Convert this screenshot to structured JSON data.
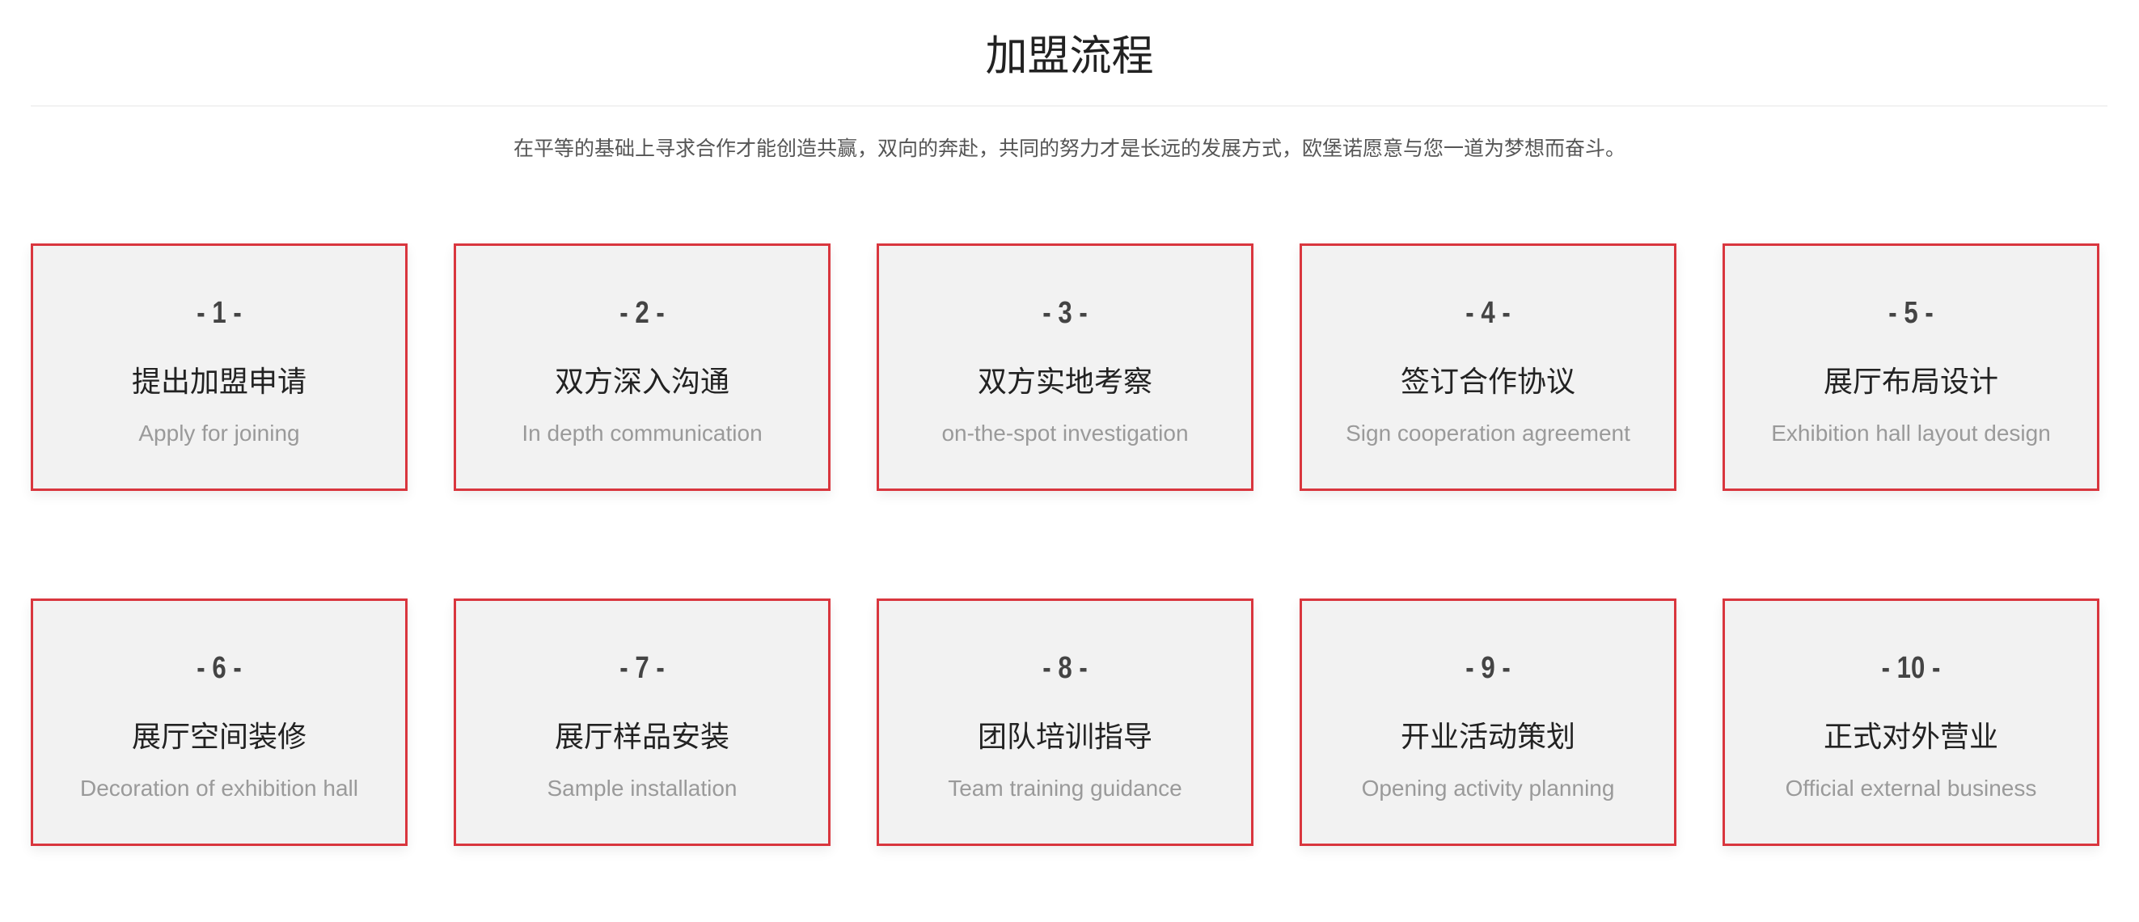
{
  "section": {
    "title": "加盟流程",
    "subtitle": "在平等的基础上寻求合作才能创造共赢，双向的奔赴，共同的努力才是长远的发展方式，欧堡诺愿意与您一道为梦想而奋斗。"
  },
  "colors": {
    "card_border": "#d9363e",
    "card_background": "#f2f2f2",
    "number_text": "#444444",
    "title_text": "#222222",
    "subtitle_text": "#9a9a9a"
  },
  "steps": [
    {
      "number": "- 1 -",
      "title": "提出加盟申请",
      "subtitle": "Apply for joining"
    },
    {
      "number": "- 2 -",
      "title": "双方深入沟通",
      "subtitle": "In depth communication"
    },
    {
      "number": "- 3 -",
      "title": "双方实地考察",
      "subtitle": "on-the-spot investigation"
    },
    {
      "number": "- 4 -",
      "title": "签订合作协议",
      "subtitle": "Sign cooperation agreement"
    },
    {
      "number": "- 5 -",
      "title": "展厅布局设计",
      "subtitle": "Exhibition hall layout design"
    },
    {
      "number": "- 6 -",
      "title": "展厅空间装修",
      "subtitle": "Decoration of exhibition hall"
    },
    {
      "number": "- 7 -",
      "title": "展厅样品安装",
      "subtitle": "Sample installation"
    },
    {
      "number": "- 8 -",
      "title": "团队培训指导",
      "subtitle": "Team training guidance"
    },
    {
      "number": "- 9 -",
      "title": "开业活动策划",
      "subtitle": "Opening activity planning"
    },
    {
      "number": "- 10 -",
      "title": "正式对外营业",
      "subtitle": "Official external business"
    }
  ]
}
